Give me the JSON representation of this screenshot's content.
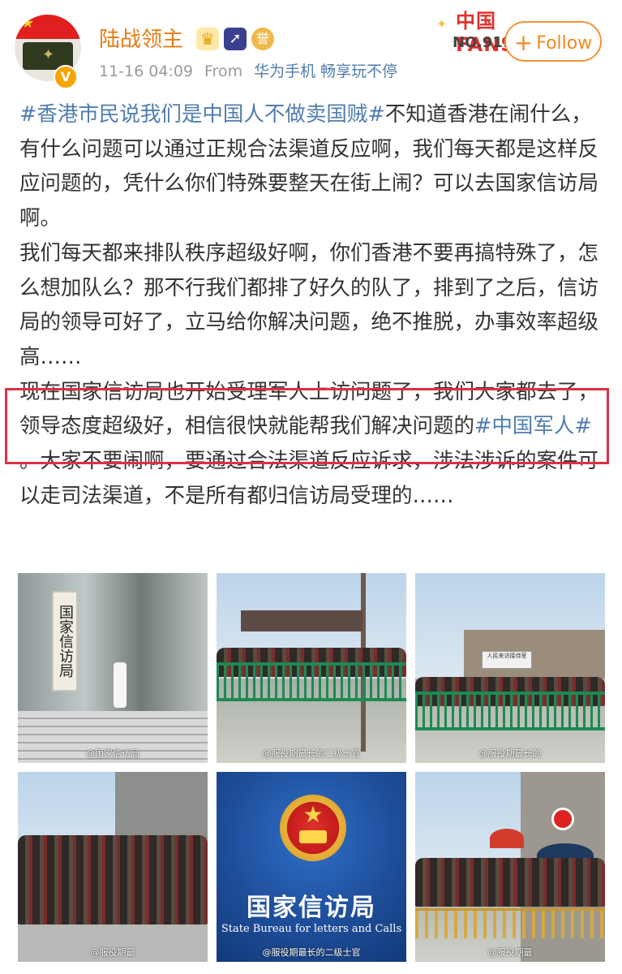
{
  "post": {
    "username": "陆战领主",
    "timestamp": "11-16 04:09",
    "source_prefix": "From",
    "source": "华为手机 畅享玩不停",
    "avatar_icon": "china-flag-military-avatar",
    "verified_badge": "V",
    "user_badges": [
      "crown-icon",
      "rocket-icon",
      "medal-icon"
    ],
    "medal_label": "誉"
  },
  "fans_card": {
    "title": "中国FANS",
    "number": "NO.9116"
  },
  "follow_button": {
    "label": "Follow",
    "icon": "+",
    "color": "#f08a22"
  },
  "content": {
    "p1_tag": "#香港市民说我们是中国人不做卖国贼#",
    "p1_text": "不知道香港在闹什么，有什么问题可以通过正规合法渠道反应啊，我们每天都是这样反应问题的，凭什么你们特殊要整天在街上闹？可以去国家信访局啊。",
    "p2_text": "我们每天都来排队秩序超级好啊，你们香港不要再搞特殊了，怎么想加队么？那不行我们都排了好久的队了，排到了之后，信访局的领导可好了，立马给你解决问题，绝不推脱，办事效率超级高……",
    "p3_text": "现在国家信访局也开始受理军人上访问题了，我们大家都去了，领导态度超级好，相信很快就能帮我们解决问题的",
    "p3_tag": "#中国军人#",
    "p3_tail": " 。大家不要闹啊，要通过合法渠道反应诉求，涉法涉诉的案件可以走司法渠道，不是所有都归信访局受理的……",
    "tag_color": "#507daf",
    "highlight_color": "#e03044"
  },
  "photos": {
    "p1_sign": "国家信访局",
    "p1_caption": "@国家信访局",
    "p2_caption": "@服役期最长的二级士官",
    "p3_sign": "人民来访接待室",
    "p3_caption": "@服役期最长的",
    "p4_caption": "@服役期最",
    "p5_title_cn": "国家信访局",
    "p5_title_en": "State Bureau for letters and Calls",
    "p5_caption": "@服役期最长的二级士官",
    "p6_caption": "@服役期最"
  }
}
